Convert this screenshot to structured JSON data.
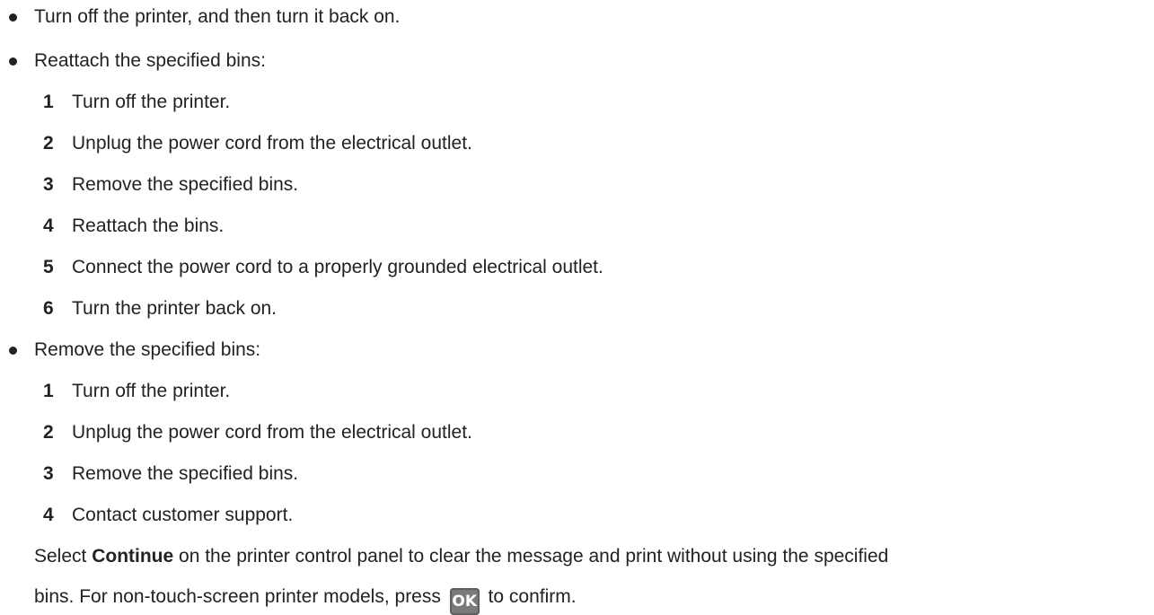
{
  "bullets": [
    "Turn off the printer, and then turn it back on.",
    "Reattach the specified bins:",
    "Remove the specified bins:"
  ],
  "reattach_steps": [
    {
      "num": "1",
      "text": "Turn off the printer."
    },
    {
      "num": "2",
      "text": "Unplug the power cord from the electrical outlet."
    },
    {
      "num": "3",
      "text": "Remove the specified bins."
    },
    {
      "num": "4",
      "text": "Reattach the bins."
    },
    {
      "num": "5",
      "text": "Connect the power cord to a properly grounded electrical outlet."
    },
    {
      "num": "6",
      "text": "Turn the printer back on."
    }
  ],
  "remove_steps": [
    {
      "num": "1",
      "text": "Turn off the printer."
    },
    {
      "num": "2",
      "text": "Unplug the power cord from the electrical outlet."
    },
    {
      "num": "3",
      "text": "Remove the specified bins."
    },
    {
      "num": "4",
      "text": "Contact customer support."
    }
  ],
  "final": {
    "prefix": "Select ",
    "bold": "Continue",
    "suffix": " on the printer control panel to clear the message and print without using the specified",
    "line2_prefix": "bins. For non-touch-screen printer models, press ",
    "ok_label": "OK",
    "line2_suffix": " to confirm."
  }
}
